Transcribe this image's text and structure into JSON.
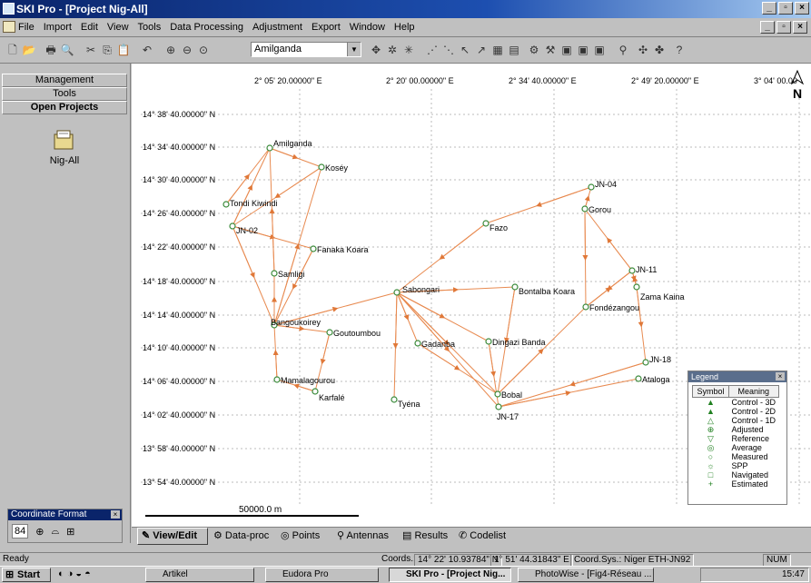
{
  "window": {
    "title": "SKI Pro - [Project Nig-All]"
  },
  "menu": [
    "File",
    "Import",
    "Edit",
    "View",
    "Tools",
    "Data Processing",
    "Adjustment",
    "Export",
    "Window",
    "Help"
  ],
  "toolbar": {
    "project_select": "Amilganda"
  },
  "left_pane": {
    "buttons": [
      "Management",
      "Tools",
      "Open Projects"
    ],
    "project_name": "Nig-All",
    "coord_format": {
      "title": "Coordinate Format",
      "selected": "84"
    }
  },
  "map": {
    "lon_labels": [
      "2° 05' 20.00000\" E",
      "2° 20' 00.00000\" E",
      "2° 34' 40.00000\" E",
      "2° 49' 20.00000\" E",
      "3° 04' 00.00"
    ],
    "lat_labels": [
      "14° 38' 40.00000\" N",
      "14° 34' 40.00000\" N",
      "14° 30' 40.00000\" N",
      "14° 26' 40.00000\" N",
      "14° 22' 40.00000\" N",
      "14° 18' 40.00000\" N",
      "14° 14' 40.00000\" N",
      "14° 10' 40.00000\" N",
      "14° 06' 40.00000\" N",
      "14° 02' 40.00000\" N",
      "13° 58' 40.00000\" N",
      "13° 54' 40.00000\" N"
    ],
    "north_label": "N",
    "scale_label": "50000.0 m",
    "points": [
      {
        "name": "Amilganda"
      },
      {
        "name": "Koséy"
      },
      {
        "name": "Tondi Kiwindi"
      },
      {
        "name": "JN-02"
      },
      {
        "name": "Fanaka Koara"
      },
      {
        "name": "Samligi"
      },
      {
        "name": "Bangoukoirey"
      },
      {
        "name": "Goutoumbou"
      },
      {
        "name": "Mamalagourou"
      },
      {
        "name": "Karfalé"
      },
      {
        "name": "Sabongari"
      },
      {
        "name": "Gadanba"
      },
      {
        "name": "Tyéna"
      },
      {
        "name": "Dingazi Banda"
      },
      {
        "name": "Bobal"
      },
      {
        "name": "JN-17"
      },
      {
        "name": "Bontalba Koara"
      },
      {
        "name": "Fazo"
      },
      {
        "name": "JN-04"
      },
      {
        "name": "Gorou"
      },
      {
        "name": "JN-11"
      },
      {
        "name": "Zama Kaina"
      },
      {
        "name": "Fondézangou"
      },
      {
        "name": "JN-18"
      },
      {
        "name": "Ataloga"
      }
    ],
    "legend": {
      "title": "Legend",
      "col_symbol": "Symbol",
      "col_meaning": "Meaning",
      "rows": [
        {
          "sym": "▲",
          "meaning": "Control - 3D"
        },
        {
          "sym": "▲",
          "meaning": "Control - 2D"
        },
        {
          "sym": "△",
          "meaning": "Control - 1D"
        },
        {
          "sym": "⊕",
          "meaning": "Adjusted"
        },
        {
          "sym": "▽",
          "meaning": "Reference"
        },
        {
          "sym": "◎",
          "meaning": "Average"
        },
        {
          "sym": "○",
          "meaning": "Measured"
        },
        {
          "sym": "☼",
          "meaning": "SPP"
        },
        {
          "sym": "□",
          "meaning": "Navigated"
        },
        {
          "sym": "+",
          "meaning": "Estimated"
        }
      ]
    }
  },
  "tabs": [
    "View/Edit",
    "Data-proc",
    "Points",
    "Antennas",
    "Results",
    "Codelist"
  ],
  "status": {
    "ready": "Ready",
    "coords_label": "Coords.:",
    "lat": "14° 22' 10.93784\" N",
    "lon": "1° 51' 44.31843\" E",
    "coordsys": "Coord.Sys.: Niger ETH-JN92",
    "num": "NUM"
  },
  "taskbar": {
    "start": "Start",
    "tasks": [
      "Artikel",
      "Eudora Pro",
      "SKI Pro - [Project Nig...",
      "PhotoWise - [Fig4-Réseau ..."
    ],
    "clock": "15:47"
  }
}
